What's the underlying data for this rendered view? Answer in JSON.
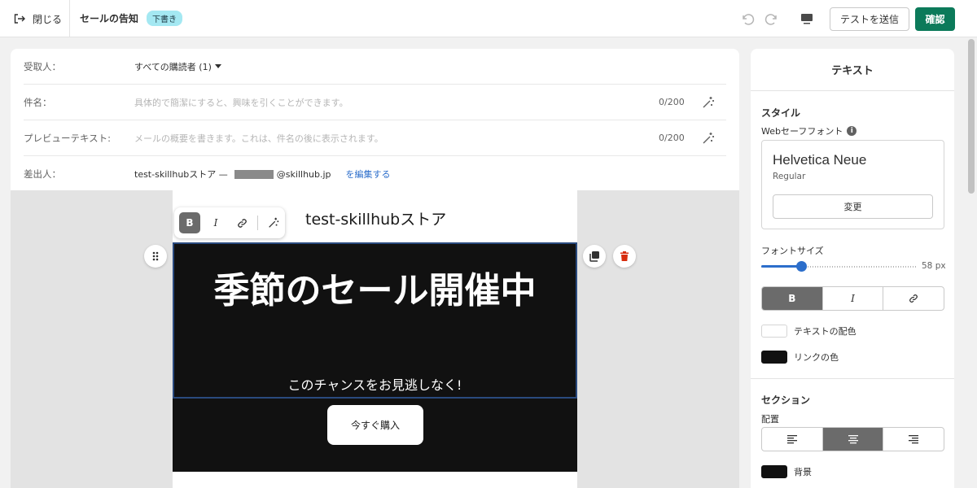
{
  "topbar": {
    "close_label": "閉じる",
    "title": "セールの告知",
    "badge": "下書き",
    "test_send": "テストを送信",
    "confirm": "確認"
  },
  "form": {
    "recipient_label": "受取人：",
    "recipient_value": "すべての購読者 (1)",
    "subject_label": "件名：",
    "subject_placeholder": "具体的で簡潔にすると、興味を引くことができます。",
    "subject_count": "0/200",
    "preview_label": "プレビューテキスト:",
    "preview_placeholder": "メールの概要を書きます。これは、件名の後に表示されます。",
    "preview_count": "0/200",
    "sender_label": "差出人：",
    "sender_name": "test-skillhubストア  —",
    "sender_domain": "@skillhub.jp",
    "sender_edit": "を編集する"
  },
  "email": {
    "store_name": "test-skillhubストア",
    "hero_heading": "季節のセール開催中",
    "hero_sub": "このチャンスをお見逃しなく!",
    "buy_button": "今すぐ購入",
    "hero_bg": "#111111"
  },
  "toolbar": {
    "bold": "B",
    "italic": "I"
  },
  "panel": {
    "title": "テキスト",
    "style_heading": "スタイル",
    "websafe_label": "Webセーフフォント",
    "info": "i",
    "font_name": "Helvetica Neue",
    "font_style": "Regular",
    "change": "変更",
    "font_size_label": "フォントサイズ",
    "font_size_value": "58 px",
    "bold": "B",
    "italic": "I",
    "text_color_label": "テキストの配色",
    "link_color_label": "リンクの色",
    "section_heading": "セクション",
    "alignment_label": "配置",
    "background_label": "背景"
  },
  "colors": {
    "accent": "#2c6ecb",
    "confirm_bg": "#0c7a5a",
    "badge_bg": "#a4e8f2",
    "delete_red": "#d72c0d"
  }
}
